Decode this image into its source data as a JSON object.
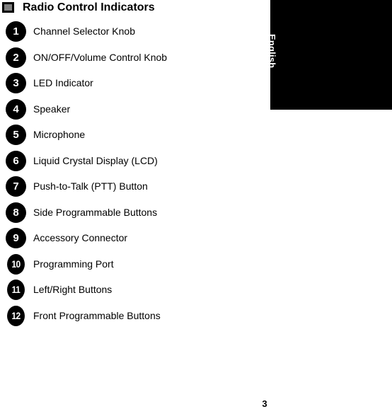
{
  "page": {
    "background_color": "#ffffff",
    "page_number": "3"
  },
  "language_tab": {
    "label": "English",
    "background_color": "#000000",
    "text_color": "#ffffff"
  },
  "header": {
    "icon": "filled-square-icon",
    "icon_outer_color": "#000000",
    "icon_inner_color": "#808080",
    "title": "Radio Control Indicators"
  },
  "indicators": [
    {
      "number": "1",
      "label": "Channel Selector Knob"
    },
    {
      "number": "2",
      "label": "ON/OFF/Volume Control Knob"
    },
    {
      "number": "3",
      "label": "LED Indicator"
    },
    {
      "number": "4",
      "label": "Speaker"
    },
    {
      "number": "5",
      "label": "Microphone"
    },
    {
      "number": "6",
      "label": "Liquid Crystal Display (LCD)"
    },
    {
      "number": "7",
      "label": "Push-to-Talk (PTT) Button"
    },
    {
      "number": "8",
      "label": "Side Programmable Buttons"
    },
    {
      "number": "9",
      "label": "Accessory Connector"
    },
    {
      "number": "10",
      "label": "Programming Port"
    },
    {
      "number": "11",
      "label": "Left/Right Buttons"
    },
    {
      "number": "12",
      "label": "Front Programmable Buttons"
    }
  ]
}
